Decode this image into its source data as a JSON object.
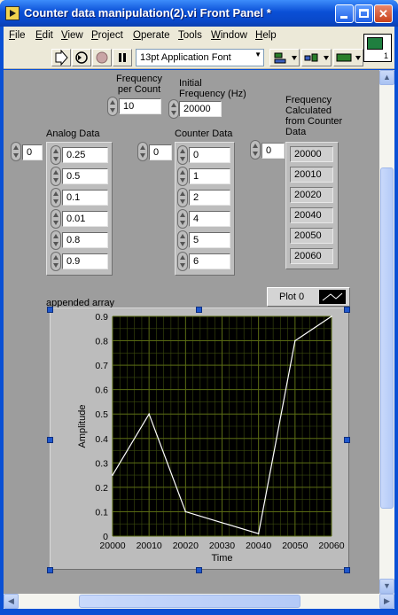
{
  "window": {
    "title": "Counter data manipulation(2).vi Front Panel *"
  },
  "menubar": {
    "items": [
      {
        "label": "File",
        "u": "F",
        "rest": "ile"
      },
      {
        "label": "Edit",
        "u": "E",
        "rest": "dit"
      },
      {
        "label": "View",
        "u": "V",
        "rest": "iew"
      },
      {
        "label": "Project",
        "u": "P",
        "rest": "roject"
      },
      {
        "label": "Operate",
        "u": "O",
        "rest": "perate"
      },
      {
        "label": "Tools",
        "u": "T",
        "rest": "ools"
      },
      {
        "label": "Window",
        "u": "W",
        "rest": "indow"
      },
      {
        "label": "Help",
        "u": "H",
        "rest": "elp"
      }
    ]
  },
  "toolbar": {
    "font_menu": "13pt Application Font",
    "icon_badge": "1"
  },
  "controls": {
    "freq_per_count": {
      "label": "Frequency\nper Count",
      "value": "10"
    },
    "initial_freq": {
      "label": "Initial\nFrequency (Hz)",
      "value": "20000"
    },
    "analog": {
      "label": "Analog Data",
      "index": "0",
      "values": [
        "0.25",
        "0.5",
        "0.1",
        "0.01",
        "0.8",
        "0.9"
      ]
    },
    "counter": {
      "label": "Counter Data",
      "index": "0",
      "values": [
        "0",
        "1",
        "2",
        "4",
        "5",
        "6"
      ]
    },
    "freq_calc": {
      "label": "Frequency\nCalculated\nfrom Counter\nData",
      "index": "0",
      "values": [
        "20000",
        "20010",
        "20020",
        "20040",
        "20050",
        "20060"
      ]
    }
  },
  "graph": {
    "label": "appended array",
    "legend": "Plot 0",
    "colors": {
      "plot_bg": "#000000",
      "grid": "#5a6b14",
      "line": "#ffffff"
    }
  },
  "chart_data": {
    "type": "line",
    "title": "appended array",
    "xlabel": "Time",
    "ylabel": "Amplitude",
    "x": [
      20000,
      20010,
      20020,
      20040,
      20050,
      20060
    ],
    "series": [
      {
        "name": "Plot 0",
        "values": [
          0.25,
          0.5,
          0.1,
          0.01,
          0.8,
          0.9
        ]
      }
    ],
    "xlim": [
      20000,
      20060
    ],
    "ylim": [
      0,
      0.9
    ],
    "xticks": [
      "20000",
      "20010",
      "20020",
      "20030",
      "20040",
      "20050",
      "20060"
    ],
    "yticks": [
      "0",
      "0.1",
      "0.2",
      "0.3",
      "0.4",
      "0.5",
      "0.6",
      "0.7",
      "0.8",
      "0.9"
    ],
    "grid": true,
    "legend": "top-right"
  }
}
